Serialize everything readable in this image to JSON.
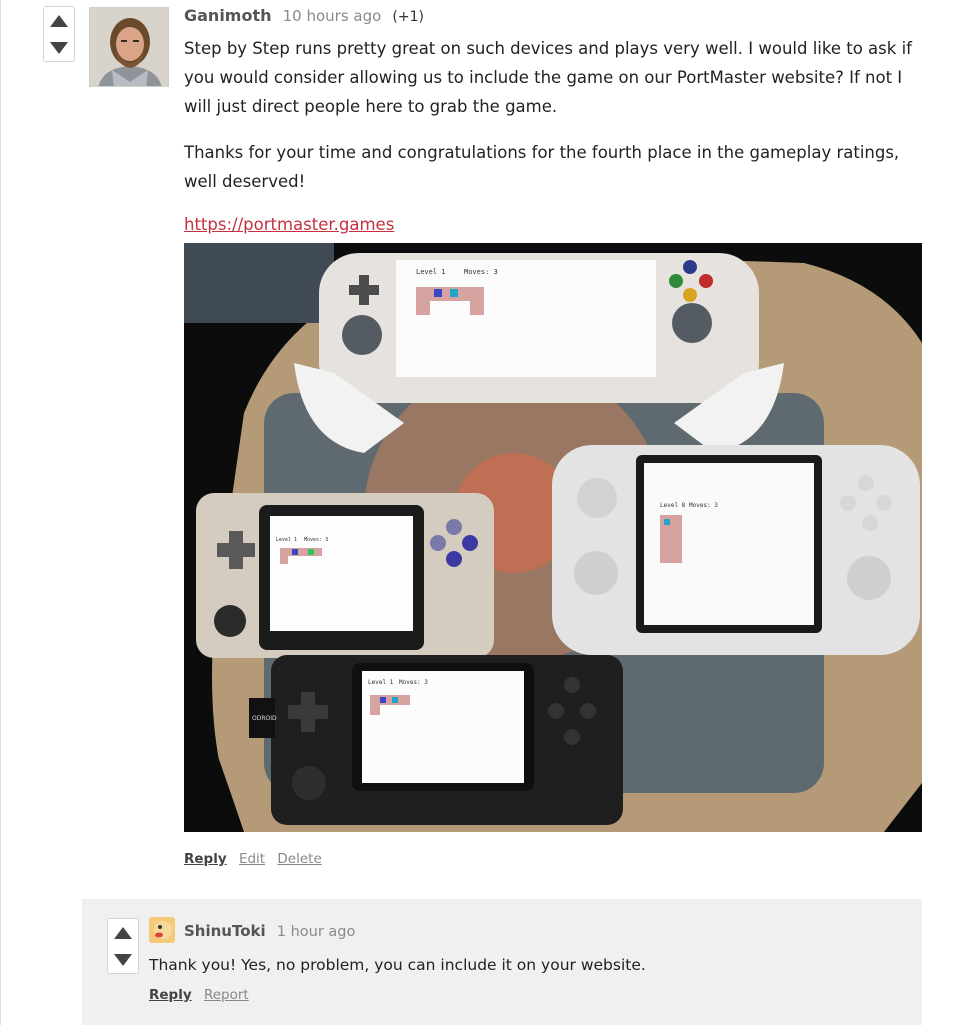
{
  "cut_header": {
    "text": ""
  },
  "comment": {
    "author": "Ganimoth",
    "time": "10 hours ago",
    "score": "(+1)",
    "paragraphs": [
      "Step by Step runs pretty great on such devices and plays very well. I would like to ask if you would consider allowing us to include the game on our PortMaster website? If not I will just direct people here to grab the game.",
      "Thanks for your time and congratulations for the fourth place in the gameplay ratings, well deserved!"
    ],
    "link": "https://portmaster.games",
    "actions": [
      "Reply",
      "Edit",
      "Delete"
    ],
    "screens": [
      {
        "level": "Level 1",
        "moves": "Moves: 3"
      },
      {
        "level": "Level 1",
        "moves": "Moves: 3"
      },
      {
        "level": "Level 8",
        "moves": "Moves: 3"
      },
      {
        "level": "Level 1",
        "moves": "Moves: 3"
      }
    ],
    "device_brand": "ODROID"
  },
  "reply": {
    "author": "ShinuToki",
    "time": "1 hour ago",
    "text": "Thank you! Yes, no problem, you can include it on your website.",
    "actions": [
      "Reply",
      "Report"
    ]
  },
  "colors": {
    "link": "#c4303f",
    "reply_bg": "#f0f0f0",
    "vote_arrow": "#444444"
  },
  "icons": {
    "upvote": "triangle-up-icon",
    "downvote": "triangle-down-icon"
  }
}
